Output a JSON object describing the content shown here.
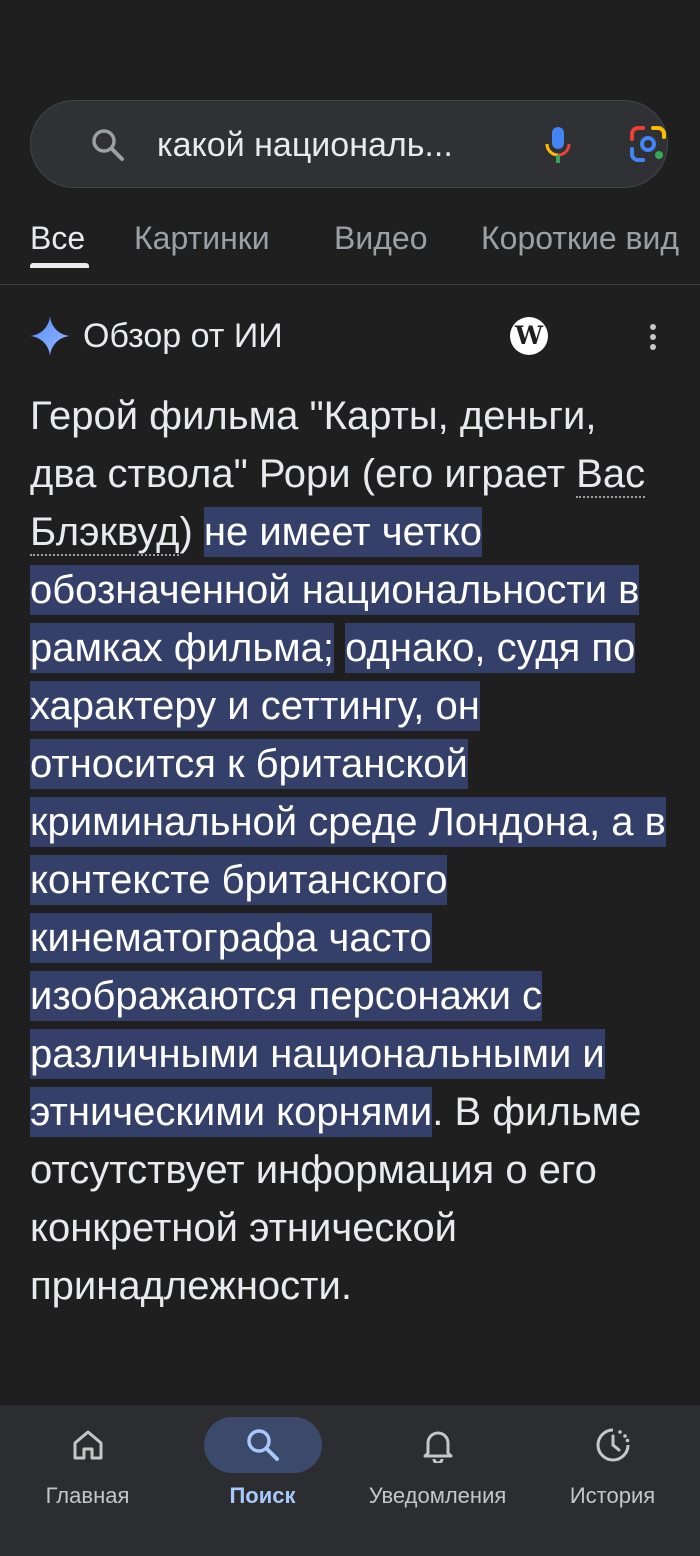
{
  "search": {
    "query": "какой националь..."
  },
  "tabs": [
    {
      "label": "Все"
    },
    {
      "label": "Картинки"
    },
    {
      "label": "Видео"
    },
    {
      "label": "Короткие вид"
    }
  ],
  "ai_overview": {
    "title": "Обзор от ИИ",
    "source_icon_letter": "W",
    "answer": {
      "t1": "Герой фильма \"Карты, деньги, два ствола\" Рори (его играет ",
      "actor": "Вас Блэквуд",
      "t2": ") ",
      "h1": "не имеет четко обозначенной национальности в рамках фильма;",
      "t3": " ",
      "h2": "однако, судя по характеру и сеттингу, он относится к британской криминальной среде Лондона, а в контексте британского кинематографа часто изображаются персонажи с различными национальными и этническими корнями",
      "t4": ". В фильме отсутствует информация о его конкретной этнической принадлежности."
    }
  },
  "bottom_nav": [
    {
      "label": "Главная",
      "icon": "home-icon"
    },
    {
      "label": "Поиск",
      "icon": "search-icon"
    },
    {
      "label": "Уведомления",
      "icon": "bell-icon"
    },
    {
      "label": "История",
      "icon": "history-icon"
    }
  ],
  "colors": {
    "background": "#1f1f1f",
    "highlight": "#35406a",
    "active_nav": "#a8c7fa"
  }
}
